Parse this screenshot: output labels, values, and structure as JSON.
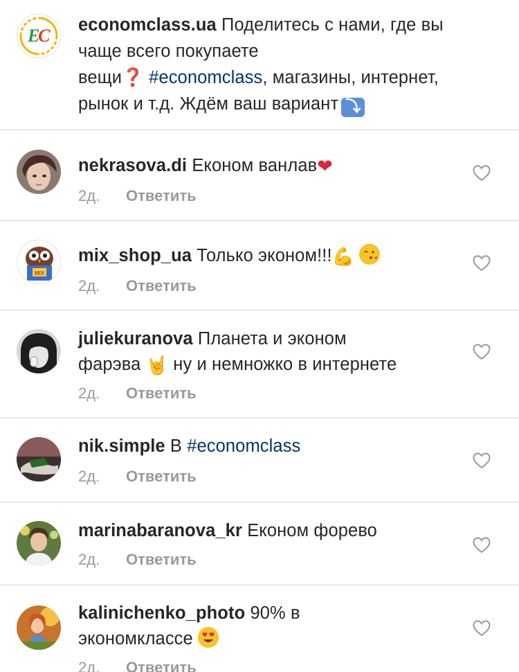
{
  "caption": {
    "username": "economclass.ua",
    "avatar_icon": "economclass-logo-icon",
    "avatar_letters": [
      "E",
      "C"
    ],
    "text_line1": "Поделитесь с нами, где вы",
    "text_line2": "чаще всего покупаете",
    "text_line3a": "вещи",
    "question_emoji": "❓",
    "hashtag": "#economclass",
    "text_line3b": ", магазины, интернет,",
    "text_line4": "рынок и т.д. Ждём ваш вариант",
    "arrow_emoji": "⤵"
  },
  "comments": [
    {
      "username": "nekrasova.di",
      "text": "Економ ванлав",
      "emoji": "❤",
      "time": "2д.",
      "reply": "Ответить",
      "avatar_icon": "user-avatar-photo"
    },
    {
      "username": "mix_shop_ua",
      "text": "Только эконом!!!",
      "emoji1": "💪",
      "emoji2": "😘",
      "time": "2д.",
      "reply": "Ответить",
      "avatar_icon": "owl-logo-avatar"
    },
    {
      "username": "juliekuranova",
      "text_line1": "Планета и эконом",
      "text_line2a": "фарэва",
      "emoji": "🤘",
      "text_line2b": "ну и немножко в интернете",
      "time": "2д.",
      "reply": "Ответить",
      "avatar_icon": "user-avatar-photo"
    },
    {
      "username": "nik.simple",
      "text": "В",
      "hashtag": "#economclass",
      "time": "2д.",
      "reply": "Ответить",
      "avatar_icon": "user-avatar-photo"
    },
    {
      "username": "marinabaranova_kr",
      "text": "Економ форево",
      "time": "2д.",
      "reply": "Ответить",
      "avatar_icon": "user-avatar-photo"
    },
    {
      "username": "kalinichenko_photo",
      "text_line1": "90% в",
      "text_line2": "экономклассе",
      "emoji": "😍",
      "time": "2д.",
      "reply": "Ответить",
      "avatar_icon": "user-avatar-photo"
    }
  ],
  "colors": {
    "text": "#262626",
    "meta": "#999999",
    "hashtag": "#003569",
    "divider": "#dbdbdb",
    "heart_outline": "#999999"
  }
}
